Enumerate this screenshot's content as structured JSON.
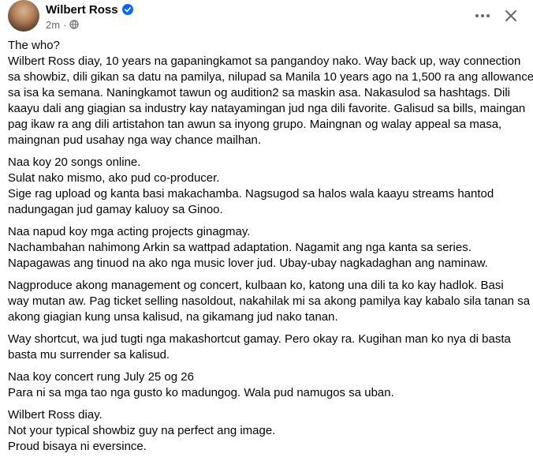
{
  "post": {
    "author": "Wilbert Ross",
    "time": "2m",
    "separator": "·",
    "icons": {
      "avatar": "profile-photo",
      "verified": "verified-badge-icon",
      "audience": "globe-icon",
      "more": "more-horizontal-icon",
      "close": "close-icon"
    },
    "colors": {
      "verified": "#0866ff",
      "meta": "#65676b",
      "text": "#050505"
    },
    "paragraphs": [
      [
        "The who?",
        "Wilbert Ross diay, 10 years na gapaningkamot sa pangandoy nako. Way back up, way connection",
        "sa showbiz, dili gikan sa datu na pamilya, nilupad sa Manila 10 years ago na 1,500 ra ang allowance",
        "sa isa ka semana. Naningkamot tawun og audition2 sa maskin asa. Nakasulod sa hashtags. Dili",
        "kaayu dali ang giagian sa industry kay natayamingan jud nga dili favorite. Galisud sa bills, maingan",
        "pag ikaw ra ang dili artistahon tan awun sa inyong grupo. Maingnan og walay appeal sa masa,",
        "maingnan pud usahay nga way chance mailhan."
      ],
      [
        "Naa koy 20 songs online.",
        "Sulat nako mismo, ako pud co-producer.",
        "Sige rag upload og kanta basi makachamba. Nagsugod sa halos wala kaayu streams hantod",
        "nadungagan jud gamay kaluoy sa Ginoo."
      ],
      [
        "Naa napud koy mga acting projects ginagmay.",
        "Nachambahan nahimong Arkin sa wattpad adaptation. Nagamit ang nga kanta sa series.",
        "Napagawas ang tinuod na ako nga music lover jud. Ubay-ubay nagkadaghan ang naminaw."
      ],
      [
        "Nagproduce akong management og concert, kulbaan ko, katong una dili ta ko kay hadlok. Basi",
        "way mutan aw. Pag ticket selling nasoldout, nakahilak mi sa akong pamilya kay kabalo sila tanan sa",
        "akong giagian kung unsa kalisud, na gikamang jud nako tanan."
      ],
      [
        "Way shortcut, wa jud tugti nga makashortcut gamay. Pero okay ra. Kugihan man ko nya di basta",
        "basta mu surrender sa kalisud."
      ],
      [
        "Naa koy concert rung July 25 og 26",
        "Para ni sa mga tao nga gusto ko madungog. Wala pud namugos sa uban."
      ],
      [
        "Wilbert Ross diay.",
        "Not your typical showbiz guy na perfect ang image.",
        "Proud bisaya ni eversince."
      ]
    ]
  }
}
